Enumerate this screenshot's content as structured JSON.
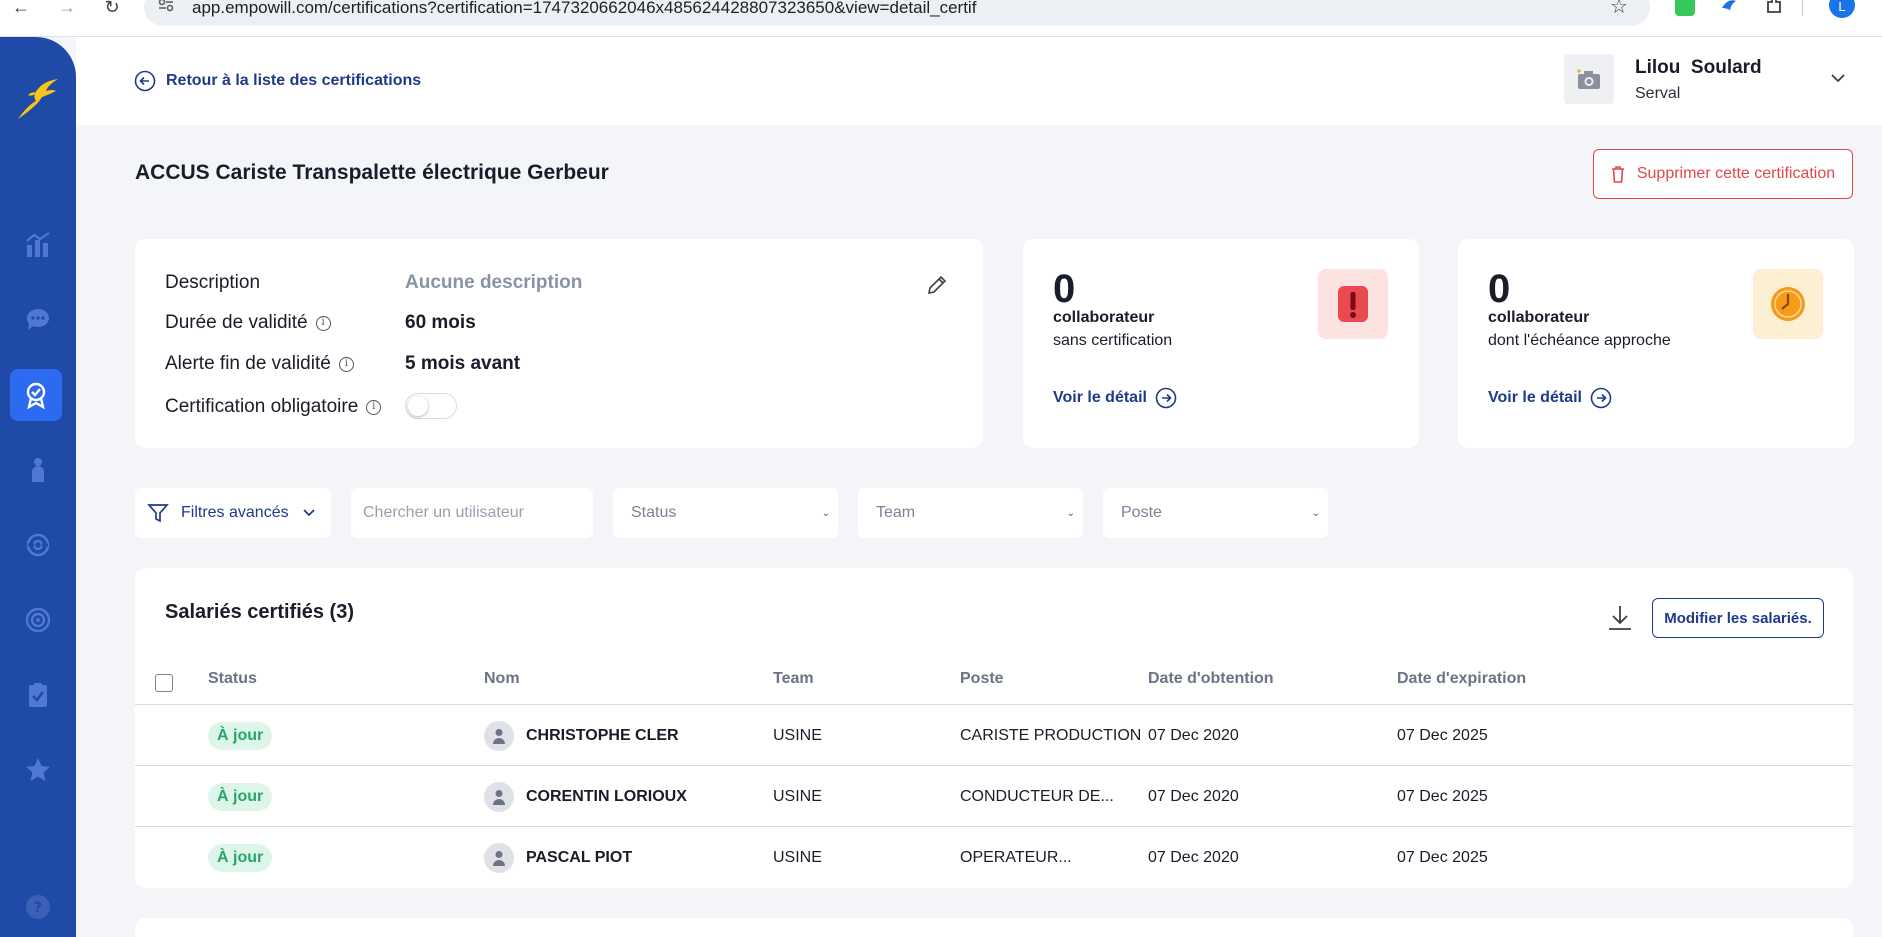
{
  "browser": {
    "url": "app.empowill.com/certifications?certification=1747320662046x485624428807323650&view=detail_certif",
    "profile_initial": "L"
  },
  "header": {
    "back_label": "Retour à la liste des certifications",
    "user_name": "Lilou  Soulard",
    "user_company": "Serval"
  },
  "page": {
    "title": "ACCUS Cariste Transpalette électrique Gerbeur",
    "delete_label": "Supprimer cette certification"
  },
  "details": {
    "description_label": "Description",
    "description_value": "Aucune description",
    "validity_label": "Durée de validité",
    "validity_value": "60 mois",
    "alert_label": "Alerte fin de validité",
    "alert_value": "5 mois avant",
    "mandatory_label": "Certification obligatoire",
    "mandatory_enabled": false
  },
  "stats": [
    {
      "number": "0",
      "title": "collaborateur",
      "subtitle": "sans certification",
      "link": "Voir le détail",
      "color": "#e84a4f"
    },
    {
      "number": "0",
      "title": "collaborateur",
      "subtitle": "dont l'échéance approche",
      "link": "Voir le détail",
      "color": "#f59a1a"
    }
  ],
  "filters": {
    "advanced_label": "Filtres avancés",
    "search_placeholder": "Chercher un utilisateur",
    "status_placeholder": "Status",
    "team_placeholder": "Team",
    "poste_placeholder": "Poste"
  },
  "table": {
    "title": "Salariés certifiés (3)",
    "modify_label": "Modifier les salariés.",
    "columns": [
      "Status",
      "Nom",
      "Team",
      "Poste",
      "Date d'obtention",
      "Date d'expiration"
    ],
    "rows": [
      {
        "status": "À jour",
        "name": "CHRISTOPHE CLER",
        "team": "USINE",
        "poste": "CARISTE PRODUCTION",
        "obtained": "07 Dec 2020",
        "expires": "07 Dec 2025"
      },
      {
        "status": "À jour",
        "name": "CORENTIN LORIOUX",
        "team": "USINE",
        "poste": "CONDUCTEUR DE...",
        "obtained": "07 Dec 2020",
        "expires": "07 Dec 2025"
      },
      {
        "status": "À jour",
        "name": "PASCAL PIOT",
        "team": "USINE",
        "poste": "OPERATEUR...",
        "obtained": "07 Dec 2020",
        "expires": "07 Dec 2025"
      }
    ]
  },
  "colors": {
    "sidebar": "#1f4aa8",
    "accent": "#1f3a8a",
    "danger": "#e0474c",
    "success": "#27a66b"
  }
}
